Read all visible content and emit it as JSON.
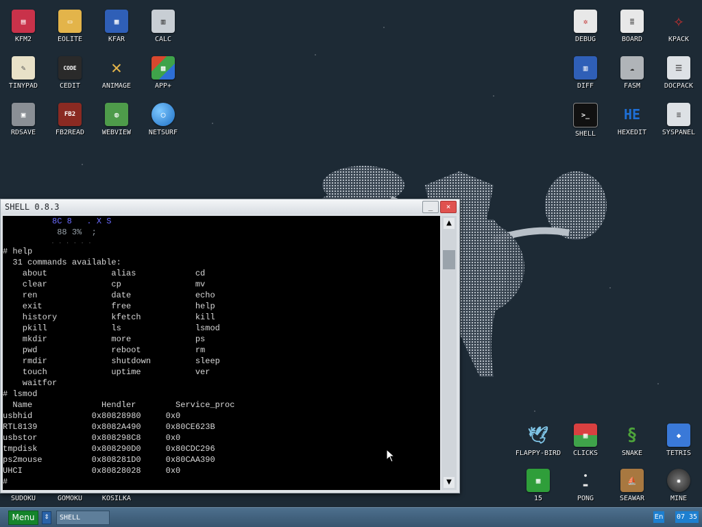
{
  "desktop": {
    "icons_left": [
      {
        "label": "KFM2",
        "icon": "floppy-icon",
        "color": "#c9324a"
      },
      {
        "label": "EOLITE",
        "icon": "folder-icon",
        "color": "#e3b44a"
      },
      {
        "label": "KFAR",
        "icon": "kfar-icon",
        "color": "#2f5fb7"
      },
      {
        "label": "CALC",
        "icon": "calculator-icon",
        "color": "#c8ced4"
      },
      {
        "label": "TINYPAD",
        "icon": "notepad-icon",
        "color": "#e8e1c8"
      },
      {
        "label": "CEDIT",
        "icon": "code-icon",
        "color": "#2a2a2a"
      },
      {
        "label": "ANIMAGE",
        "icon": "pencil-icon",
        "color": "#d8a02a"
      },
      {
        "label": "APP+",
        "icon": "rubik-cube-icon",
        "color": "#d9482e"
      },
      {
        "label": "RDSAVE",
        "icon": "disk-save-icon",
        "color": "#8a8f95"
      },
      {
        "label": "FB2READ",
        "icon": "book-icon",
        "color": "#8a2a22"
      },
      {
        "label": "WEBVIEW",
        "icon": "web-icon",
        "color": "#4e9b4a"
      },
      {
        "label": "NETSURF",
        "icon": "globe-icon",
        "color": "#2d8fe0"
      }
    ],
    "icons_right": [
      {
        "label": "DEBUG",
        "icon": "bug-icon",
        "color": "#e8e8e8"
      },
      {
        "label": "BOARD",
        "icon": "board-icon",
        "color": "#e8e8e8"
      },
      {
        "label": "KPACK",
        "icon": "wrench-icon",
        "color": "#c43030"
      },
      {
        "label": "DIFF",
        "icon": "diff-icon",
        "color": "#2f5fb7"
      },
      {
        "label": "FASM",
        "icon": "fasm-icon",
        "color": "#b0b4b8"
      },
      {
        "label": "DOCPACK",
        "icon": "drawers-icon",
        "color": "#dde1e5"
      },
      {
        "label": "SHELL",
        "icon": "terminal-icon",
        "color": "#111"
      },
      {
        "label": "HEXEDIT",
        "icon": "hex-icon",
        "color": "#1e6fd6"
      },
      {
        "label": "SYSPANEL",
        "icon": "sliders-icon",
        "color": "#dde1e5"
      }
    ],
    "icons_bottom_right": [
      {
        "label": "FLAPPY-BIRD",
        "icon": "bird-icon",
        "color": "#7fc4e6"
      },
      {
        "label": "CLICKS",
        "icon": "blocks-icon",
        "color": "#d94040"
      },
      {
        "label": "SNAKE",
        "icon": "snake-icon",
        "color": "#4da33b"
      },
      {
        "label": "TETRIS",
        "icon": "tetris-icon",
        "color": "#3a79d8"
      },
      {
        "label": "15",
        "icon": "grid-icon",
        "color": "#2f9e3a"
      },
      {
        "label": "PONG",
        "icon": "pong-icon",
        "color": "#e8e8e8"
      },
      {
        "label": "SEAWAR",
        "icon": "ship-icon",
        "color": "#a87840"
      },
      {
        "label": "MINE",
        "icon": "mine-icon",
        "color": "#555"
      }
    ],
    "icons_bottom_left": [
      {
        "label": "SUDOKU"
      },
      {
        "label": "GOMOKU"
      },
      {
        "label": "KOSILKA"
      }
    ]
  },
  "shell_window": {
    "title": "SHELL 0.8.3",
    "minimize": "_",
    "close": "×",
    "scroll_up": "▲",
    "scroll_down": "▼",
    "logo_lines": [
      "          8C 8   . X S",
      "           88 3%  ;",
      "             . . . . . ."
    ],
    "lines": [
      "# help",
      "  31 commands available:",
      "    about             alias            cd",
      "    clear             cp               mv",
      "    ren               date             echo",
      "    exit              free             help",
      "    history           kfetch           kill",
      "    pkill             ls               lsmod",
      "    mkdir             more             ps",
      "    pwd               reboot           rm",
      "    rmdir             shutdown         sleep",
      "    touch             uptime           ver",
      "    waitfor",
      "# lsmod",
      "  Name              Hendler        Service_proc",
      "usbhid            0x80828980     0x0",
      "RTL8139           0x8082A490     0x80CE623B",
      "usbstor           0x808298C8     0x0",
      "tmpdisk           0x808290D0     0x80CDC296",
      "ps2mouse          0x808281D0     0x80CAA390",
      "UHCI              0x80828028     0x0",
      "# "
    ]
  },
  "taskbar": {
    "menu_label": "Menu",
    "swap_label": "⇕",
    "task_label": "SHELL",
    "lang": "En",
    "clock": "07 35"
  },
  "colors": {
    "background": "#1d2a35",
    "taskbar": "#4d6f8d",
    "menu_button": "#15842b",
    "tray": "#1d7fd0"
  }
}
